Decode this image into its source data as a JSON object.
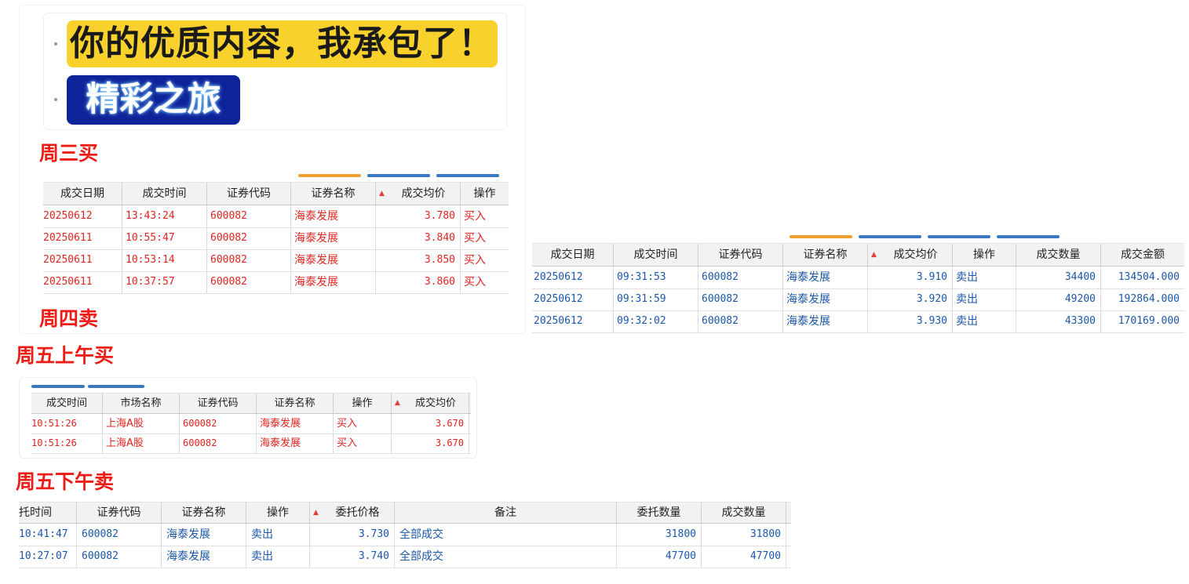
{
  "banners": {
    "yellow_text": "你的优质内容，我承包了！",
    "blue_text": "精彩之旅"
  },
  "sections": {
    "wed_buy": "周三买",
    "thu_sell": "周四卖",
    "fri_am_buy": "周五上午买",
    "fri_pm_sell": "周五下午卖"
  },
  "colors": {
    "buy": "#e0241f",
    "sell": "#1b57a8",
    "heading": "#ee1c16",
    "sort_indicator": "#e23c3c"
  },
  "icons": {
    "sort": "sort-ascending-triangle-icon"
  },
  "table1": {
    "headers": [
      "成交日期",
      "成交时间",
      "证券代码",
      "证券名称",
      "成交均价",
      "操作"
    ],
    "rows": [
      [
        "20250612",
        "13:43:24",
        "600082",
        "海泰发展",
        "3.780",
        "买入"
      ],
      [
        "20250611",
        "10:55:47",
        "600082",
        "海泰发展",
        "3.840",
        "买入"
      ],
      [
        "20250611",
        "10:53:14",
        "600082",
        "海泰发展",
        "3.850",
        "买入"
      ],
      [
        "20250611",
        "10:37:57",
        "600082",
        "海泰发展",
        "3.860",
        "买入"
      ]
    ]
  },
  "table2": {
    "headers": [
      "成交日期",
      "成交时间",
      "证券代码",
      "证券名称",
      "成交均价",
      "操作",
      "成交数量",
      "成交金额"
    ],
    "rows": [
      [
        "20250612",
        "09:31:53",
        "600082",
        "海泰发展",
        "3.910",
        "卖出",
        "34400",
        "134504.000"
      ],
      [
        "20250612",
        "09:31:59",
        "600082",
        "海泰发展",
        "3.920",
        "卖出",
        "49200",
        "192864.000"
      ],
      [
        "20250612",
        "09:32:02",
        "600082",
        "海泰发展",
        "3.930",
        "卖出",
        "43300",
        "170169.000"
      ]
    ]
  },
  "table3": {
    "headers": [
      "成交时间",
      "市场名称",
      "证券代码",
      "证券名称",
      "操作",
      "成交均价"
    ],
    "rows": [
      [
        "10:51:26",
        "上海A股",
        "600082",
        "海泰发展",
        "买入",
        "3.670"
      ],
      [
        "10:51:26",
        "上海A股",
        "600082",
        "海泰发展",
        "买入",
        "3.670"
      ]
    ]
  },
  "table4": {
    "headers": [
      "托时间",
      "证券代码",
      "证券名称",
      "操作",
      "委托价格",
      "备注",
      "委托数量",
      "成交数量"
    ],
    "rows": [
      [
        "10:41:47",
        "600082",
        "海泰发展",
        "卖出",
        "3.730",
        "全部成交",
        "31800",
        "31800"
      ],
      [
        "10:27:07",
        "600082",
        "海泰发展",
        "卖出",
        "3.740",
        "全部成交",
        "47700",
        "47700"
      ]
    ]
  }
}
